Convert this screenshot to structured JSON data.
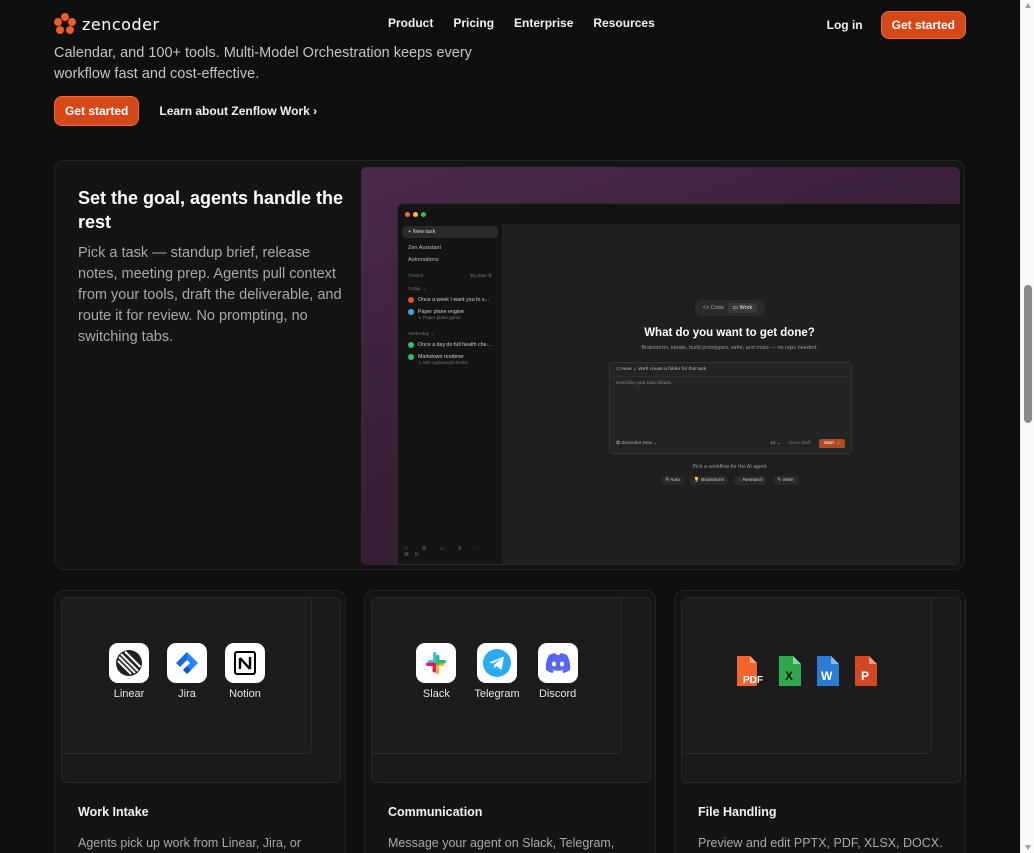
{
  "nav": {
    "logo_text": "zencoder",
    "links": [
      "Product",
      "Pricing",
      "Enterprise",
      "Resources"
    ],
    "login": "Log in",
    "cta": "Get started"
  },
  "hero": {
    "text": "Calendar, and 100+ tools. Multi-Model Orchestration keeps every workflow fast and cost-effective.",
    "cta": "Get started",
    "learn": "Learn about Zenflow Work",
    "learn_arrow": "›"
  },
  "feature": {
    "title": "Set the goal, agents handle the rest",
    "description": "Pick a task — standup brief, release notes, meeting prep. Agents pull context from your tools, draft the deliverable, and route it for review. No prompting, no switching tabs.",
    "app": {
      "new_task": "+ New task",
      "zen_assistant": "Zen Assistant",
      "automations": "Automations",
      "tasks_label": "TASKS",
      "sort_label": "By date ⇅",
      "group_today": "Today ⌄",
      "group_yesterday": "Yesterday ⌄",
      "tasks_today": [
        {
          "title": "Once a week I want you to s...",
          "sub": "",
          "color": "#e0522a"
        },
        {
          "title": "Paper plane engine",
          "sub": "↳ Paper plane game",
          "color": "#4aa3f0"
        }
      ],
      "tasks_yesterday": [
        {
          "title": "Once a day do full health che...",
          "sub": "",
          "color": "#2fbf71"
        },
        {
          "title": "Markdown renderer",
          "sub": "↳ MD Lightweight Editor",
          "color": "#2fbf71"
        }
      ],
      "mode_code": "<> Code",
      "mode_work": "▭ Work",
      "main_title": "What do you want to get done?",
      "main_sub": "Brainstorm, ideate, build prototypes, write, and more — no repo needed.",
      "prompt_head": "▭ New ⌄   We'll create a folder for this task",
      "prompt_placeholder": "Describe your task details.",
      "model": "✿ Zencoder Max ⌄",
      "count": "x1 ⌄",
      "save_draft": "Save draft",
      "start": "Start →",
      "workflow_label": "Pick a workflow for the AI agent",
      "workflows": [
        "⚲ Auto",
        "💡 Brainstorm",
        "◌ Research",
        "✎ Write"
      ],
      "bottom_icons": "⚇ ⚙ ▭ ⚲ ⋯ ⌘K"
    }
  },
  "cards": [
    {
      "title": "Work Intake",
      "description": "Agents pick up work from Linear, Jira, or",
      "tiles": [
        "Linear",
        "Jira",
        "Notion"
      ]
    },
    {
      "title": "Communication",
      "description": "Message your agent on Slack, Telegram,",
      "tiles": [
        "Slack",
        "Telegram",
        "Discord"
      ]
    },
    {
      "title": "File Handling",
      "description": "Preview and edit PPTX, PDF, XLSX, DOCX.",
      "files": [
        {
          "label": "PDF",
          "color": "#f0652f"
        },
        {
          "label": "X",
          "color": "#2fa84f"
        },
        {
          "label": "W",
          "color": "#2b7cd3"
        },
        {
          "label": "P",
          "color": "#d24726"
        }
      ]
    }
  ],
  "colors": {
    "accent": "#d4481a",
    "background": "#0f0f0f"
  }
}
